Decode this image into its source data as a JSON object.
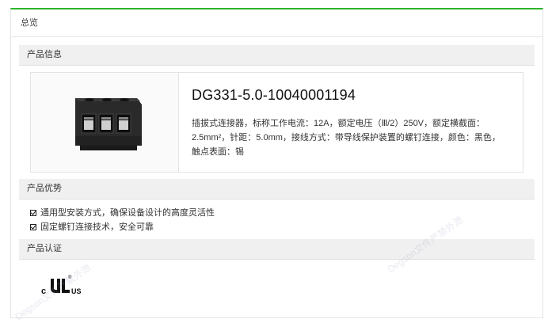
{
  "tabs": {
    "overview": "总览"
  },
  "sections": {
    "product_info": "产品信息",
    "advantages": "产品优势",
    "certification": "产品认证"
  },
  "product": {
    "model": "DG331-5.0-10040001194",
    "description": "插拔式连接器，标称工作电流：12A，额定电压（Ⅲ/2）250V，额定横截面：2.5mm²，针距：5.0mm，接线方式：带导线保护装置的螺钉连接，颜色：黑色，触点表面：锡"
  },
  "advantages": [
    "通用型安装方式，确保设备设计的高度灵活性",
    "固定螺钉连接技术，安全可靠"
  ],
  "certification": {
    "mark_left": "c",
    "mark_right": "US",
    "registered": "®"
  },
  "watermark": "Degson文件严禁外泄",
  "colors": {
    "accent_line": "#2db52d"
  }
}
